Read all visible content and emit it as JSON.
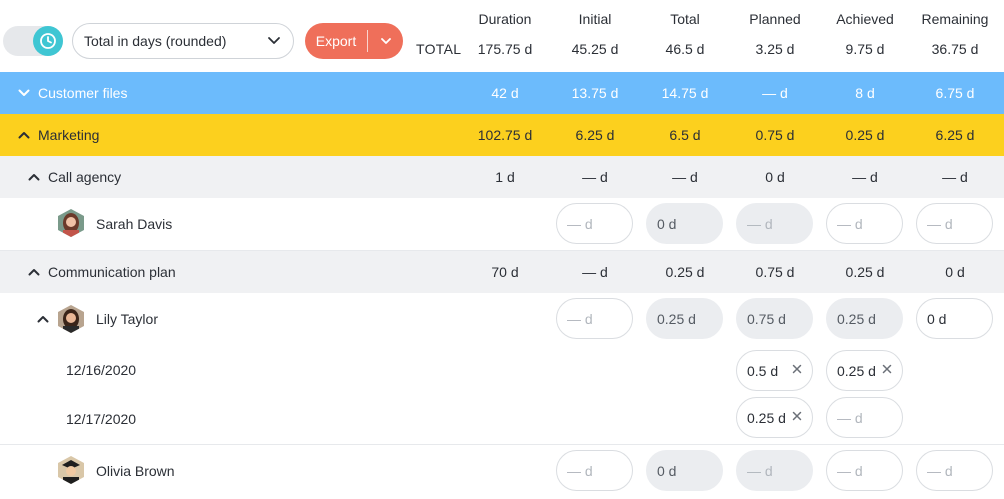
{
  "header": {
    "select_value": "Total in days (rounded)",
    "export_label": "Export",
    "total_label": "TOTAL",
    "columns": [
      "Duration",
      "Initial",
      "Total",
      "Planned",
      "Achieved",
      "Remaining"
    ],
    "totals": [
      "175.75 d",
      "45.25 d",
      "46.5 d",
      "3.25 d",
      "9.75 d",
      "36.75 d"
    ]
  },
  "colors": {
    "accent_teal": "#3fc6d3",
    "export": "#ef6f5a",
    "customer_files_band": "#6cbbfc",
    "marketing_band": "#fcd01e",
    "task_band": "#f0f1f3"
  },
  "groups": {
    "customer_files": {
      "label": "Customer files",
      "values": [
        "42 d",
        "13.75 d",
        "14.75 d",
        "— d",
        "8 d",
        "6.75 d"
      ]
    },
    "marketing": {
      "label": "Marketing",
      "values": [
        "102.75 d",
        "6.25 d",
        "6.5 d",
        "0.75 d",
        "0.25 d",
        "6.25 d"
      ]
    }
  },
  "tasks": {
    "call_agency": {
      "label": "Call agency",
      "values": [
        "1 d",
        "— d",
        "— d",
        "0 d",
        "— d",
        "— d"
      ]
    },
    "communication_plan": {
      "label": "Communication plan",
      "values": [
        "70 d",
        "— d",
        "0.25 d",
        "0.75 d",
        "0.25 d",
        "0 d"
      ]
    }
  },
  "people": {
    "sarah": {
      "name": "Sarah Davis",
      "initial": "— d",
      "total": "0 d",
      "planned": "— d",
      "achieved": "— d",
      "remaining": "— d"
    },
    "lily": {
      "name": "Lily Taylor",
      "initial": "— d",
      "total": "0.25 d",
      "planned": "0.75 d",
      "achieved": "0.25 d",
      "remaining": "0 d"
    },
    "olivia": {
      "name": "Olivia Brown",
      "initial": "— d",
      "total": "0 d",
      "planned": "— d",
      "achieved": "— d",
      "remaining": "— d"
    }
  },
  "dates": [
    {
      "date": "12/16/2020",
      "planned": "0.5 d",
      "achieved": "0.25 d"
    },
    {
      "date": "12/17/2020",
      "planned": "0.25 d",
      "achieved": "— d"
    }
  ]
}
